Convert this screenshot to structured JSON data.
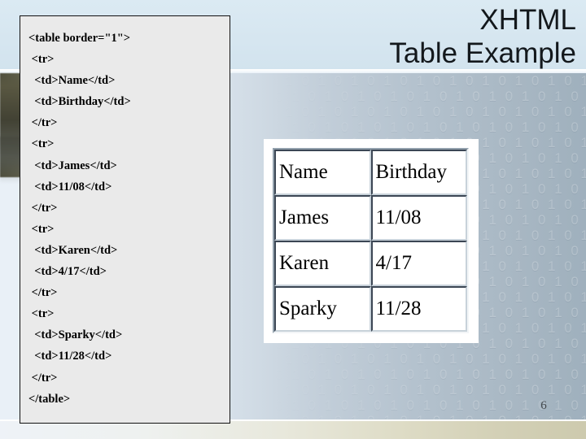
{
  "slide": {
    "title_line1": "XHTML",
    "title_line2": "Table Example",
    "page_number": "6",
    "accent_top_color": "#d6e6f0",
    "accent_mid_color": "#b3c1cd",
    "accent_bottom_color": "#d3d0b6",
    "code_box_bg": "#eaeaea",
    "code_text_color": "#000000"
  },
  "code": {
    "language": "xhtml",
    "lines": [
      "<table border=\"1\">",
      " <tr>",
      "  <td>Name</td>",
      "  <td>Birthday</td>",
      " </tr>",
      " <tr>",
      "  <td>James</td>",
      "  <td>11/08</td>",
      " </tr>",
      " <tr>",
      "  <td>Karen</td>",
      "  <td>4/17</td>",
      " </tr>",
      " <tr>",
      "  <td>Sparky</td>",
      "  <td>11/28</td>",
      " </tr>",
      "</table>"
    ]
  },
  "rendered_table": {
    "border": "1",
    "rows": [
      {
        "name": "Name",
        "birthday": "Birthday"
      },
      {
        "name": "James",
        "birthday": "11/08"
      },
      {
        "name": "Karen",
        "birthday": "4/17"
      },
      {
        "name": "Sparky",
        "birthday": "11/28"
      }
    ]
  },
  "background": {
    "binary_rows": [
      "0 1 0 1 0 1 0 1 0 1 0 1 0 1 0 1 0 1 0 1 0 1",
      "1 0 1 0 1 0 1 0 1 0 1 0 1 0 1 0 1 0 1 0 1 0",
      "0 1 0 1 0 1 0 1 0 1 0 1 0 1 0 1 0 1 0 1 0 1",
      "1 0 1 0 1 0 1 0 1 0 1 0 1 0 1 0 1 0 1 0 1 0",
      "0 1 0 1 0 1 0 1 0 1 0 1 0 1 0 1 0 1 0 1 0 1",
      "1 0 1 0 1 0 1 0 1 0 1 0 1 0 1 0 1 0 1 0 1 0",
      "0 1 0 1 0 1 0 1 0 1 0 1 0 1 0 1 0 1 0 1 0 1",
      "1 0 1 0 1 0 1 0 1 0 1 0 1 0 1 0 1 0 1 0 1 0",
      "0 1 0 1 0 1 0 1 0 1 0 1 0 1 0 1 0 1 0 1 0 1",
      "1 0 1 0 1 0 1 0 1 0 1 0 1 0 1 0 1 0 1 0 1 0",
      "0 1 0 1 0 1 0 1 0 1 0 1 0 1 0 1 0 1 0 1 0 1",
      "1 0 1 0 1 0 1 0 1 0 1 0 1 0 1 0 1 0 1 0 1 0",
      "0 1 0 1 0 1 0 1 0 1 0 1 0 1 0 1 0 1 0 1 0 1",
      "1 0 1 0 1 0 1 0 1 0 1 0 1 0 1 0 1 0 1 0 1 0",
      "0 1 0 1 0 1 0 1 0 1 0 1 0 1 0 1 0 1 0 1 0 1",
      "1 0 1 0 1 0 1 0 1 0 1 0 1 0 1 0 1 0 1 0 1 0",
      "0 1 0 1 0 1 0 1 0 1 0 1 0 1 0 1 0 1 0 1 0 1",
      "1 0 1 0 1 0 1 0 1 0 1 0 1 0 1 0 1 0 1 0 1 0",
      "0 1 0 1 0 1 0 1 0 1 0 1 0 1 0 1 0 1 0 1 0 1",
      "1 0 1 0 1 0 1 0 1 0 1 0 1 0 1 0 1 0 1 0 1 0",
      "0 1 0 1 0 1 0 1 0 1 0 1 0 1 0 1 0 1 0 1 0 1",
      "1 0 1 0 1 0 1 0 1 0 1 0 1 0 1 0 1 0 1 0 1 0",
      "0 1 0 1 0 1 0 1 0 1 0 1 0 1 0 1 0 1 0 1 0 1"
    ]
  }
}
